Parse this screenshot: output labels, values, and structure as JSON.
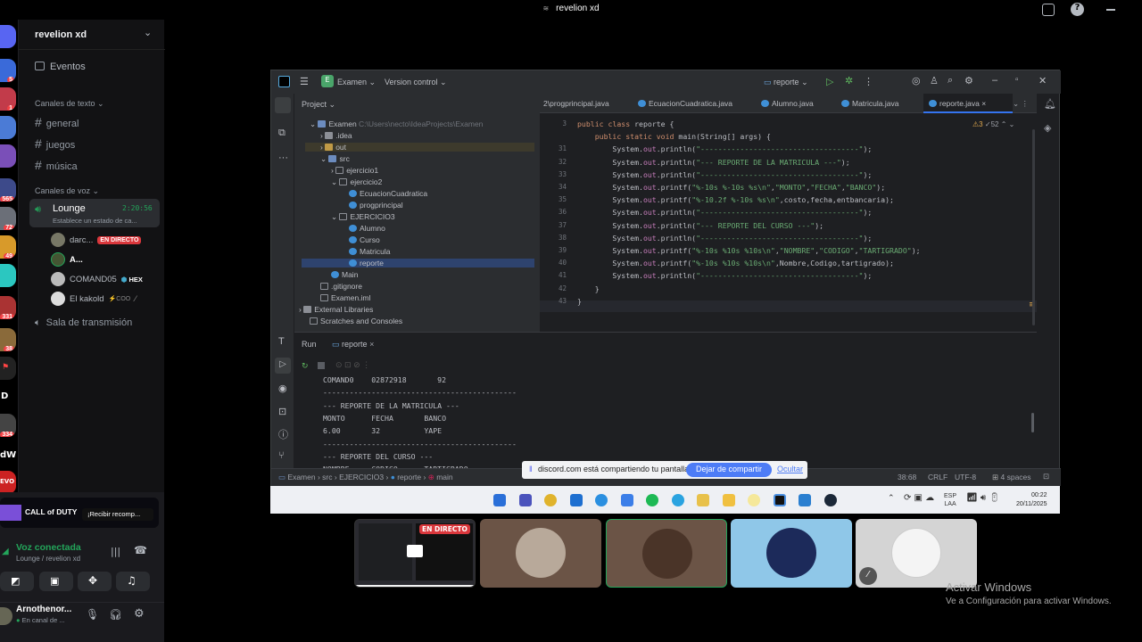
{
  "window": {
    "title": "revelion xd"
  },
  "guild_badges": [
    "5",
    "1",
    "565",
    "72",
    "49",
    "331",
    "38",
    "334"
  ],
  "guild_letters": [
    "D",
    "dW",
    "EVO"
  ],
  "sidebar": {
    "server_name": "revelion xd",
    "events_label": "Eventos",
    "text_category": "Canales de texto",
    "text_channels": [
      "general",
      "juegos",
      "música"
    ],
    "voice_category": "Canales de voz",
    "voice_channel": {
      "name": "Lounge",
      "timer": "2:20:56",
      "status": "Establece un estado de ca..."
    },
    "voice_users": [
      {
        "name": "darc...",
        "badge": "EN DIRECTO"
      },
      {
        "name": "A..."
      },
      {
        "name": "COMAND05",
        "tag": "HEX"
      },
      {
        "name": "El kakold",
        "tag": "COO"
      }
    ],
    "stage_channel": "Sala de transmisión"
  },
  "promo": {
    "game": "CALL of DUTY",
    "label": "¡Recibir recomp..."
  },
  "voice_panel": {
    "status": "Voz conectada",
    "location": "Lounge / revelion xd"
  },
  "user": {
    "name": "Arnothenor...",
    "status": "En canal de ..."
  },
  "ide": {
    "project": "Examen",
    "vcs": "Version control",
    "run_config": "reporte",
    "tabs": [
      "2\\progprincipal.java",
      "EcuacionCuadratica.java",
      "Alumno.java",
      "Matricula.java",
      "reporte.java"
    ],
    "project_label": "Project",
    "project_path": "C:\\Users\\necto\\IdeaProjects\\Examen",
    "tree": [
      ".idea",
      "out",
      "src",
      "ejercicio1",
      "ejercicio2",
      "EcuacionCuadratica",
      "progprincipal",
      "EJERCICIO3",
      "Alumno",
      "Curso",
      "Matricula",
      "reporte",
      "Main",
      ".gitignore",
      "Examen.iml",
      "External Libraries",
      "Scratches and Consoles"
    ],
    "inspections": {
      "warnings": "3",
      "weak": "52"
    },
    "code_lines": [
      {
        "n": "3",
        "t": "public class reporte {"
      },
      {
        "n": "",
        "t": "    public static void main(String[] args) {"
      },
      {
        "n": "31",
        "t": "        System.out.println(\"------------------------------------\");"
      },
      {
        "n": "32",
        "t": "        System.out.println(\"--- REPORTE DE LA MATRICULA ---\");"
      },
      {
        "n": "33",
        "t": "        System.out.println(\"------------------------------------\");"
      },
      {
        "n": "34",
        "t": "        System.out.printf(\"%-10s %-10s %s\\n\",\"MONTO\",\"FECHA\",\"BANCO\");"
      },
      {
        "n": "35",
        "t": "        System.out.printf(\"%-10.2f %-10s %s\\n\",costo,fecha,entbancaria);"
      },
      {
        "n": "36",
        "t": "        System.out.println(\"------------------------------------\");"
      },
      {
        "n": "37",
        "t": "        System.out.println(\"--- REPORTE DEL CURSO ---\");"
      },
      {
        "n": "38",
        "t": "        System.out.println(\"------------------------------------\");"
      },
      {
        "n": "39",
        "t": "        System.out.printf(\"%-10s %10s %10s\\n\",\"NOMBRE\",\"CODIGO\",\"TARTIGRADO\");"
      },
      {
        "n": "40",
        "t": "        System.out.printf(\"%-10s %10s %10s\\n\",Nombre,Codigo,tartigrado);"
      },
      {
        "n": "41",
        "t": "        System.out.println(\"------------------------------------\");"
      },
      {
        "n": "42",
        "t": "    }"
      },
      {
        "n": "43",
        "t": "}"
      }
    ],
    "run_label": "Run",
    "run_tab": "reporte",
    "console": [
      "COMAND0    02872918       92",
      "--------------------------------------------",
      "--- REPORTE DE LA MATRICULA ---",
      "MONTO      FECHA       BANCO",
      "6.00       32          YAPE",
      "--------------------------------------------",
      "--- REPORTE DEL CURSO ---",
      "NOMBRE     CODIGO      TARTIGRADO"
    ],
    "breadcrumb": [
      "Examen",
      "src",
      "EJERCICIO3",
      "reporte",
      "main"
    ],
    "status": {
      "pos": "38:68",
      "eol": "CRLF",
      "enc": "UTF-8",
      "indent": "4 spaces"
    }
  },
  "share_banner": {
    "text": "discord.com está compartiendo tu pantalla.",
    "stop": "Dejar de compartir",
    "hide": "Ocultar"
  },
  "taskbar": {
    "lang": "ESP",
    "lang2": "LAA",
    "time": "00:22",
    "date": "20/11/2025"
  },
  "tiles": {
    "live_badge": "EN DIRECTO"
  },
  "watermark": {
    "title": "Activar Windows",
    "subtitle": "Ve a Configuración para activar Windows."
  }
}
